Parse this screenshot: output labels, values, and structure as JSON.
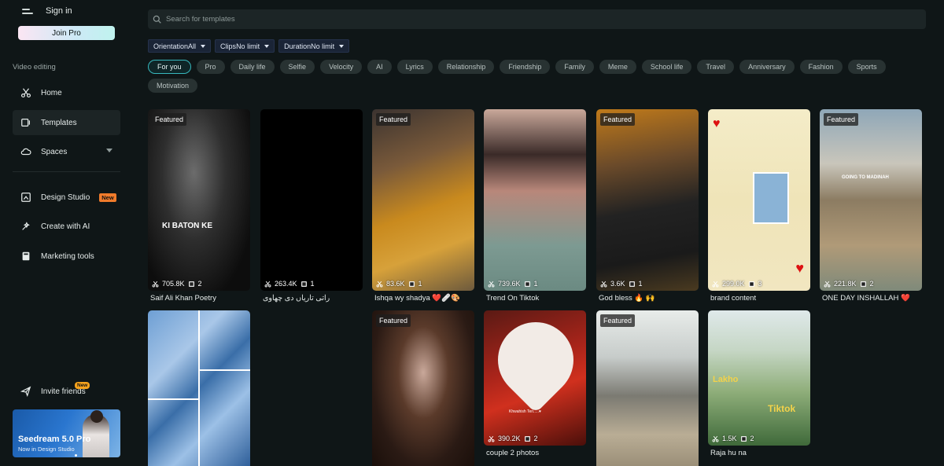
{
  "sidebar": {
    "sign_in": "Sign in",
    "join_pro": "Join Pro",
    "section_label": "Video editing",
    "nav": [
      {
        "label": "Home",
        "icon": "scissors-icon"
      },
      {
        "label": "Templates",
        "icon": "template-icon"
      },
      {
        "label": "Spaces",
        "icon": "cloud-icon"
      },
      {
        "label": "Design Studio",
        "icon": "design-icon",
        "badge": "New"
      },
      {
        "label": "Create with AI",
        "icon": "sparkle-icon"
      },
      {
        "label": "Marketing tools",
        "icon": "marketing-icon"
      }
    ],
    "invite": {
      "label": "Invite friends",
      "badge": "New"
    },
    "promo": {
      "title": "Seedream 5.0 Pro",
      "subtitle": "Now in Design Studio"
    }
  },
  "search": {
    "placeholder": "Search for templates"
  },
  "filters": [
    {
      "label": "Orientation",
      "value": "All"
    },
    {
      "label": "Clips",
      "value": "No limit"
    },
    {
      "label": "Duration",
      "value": "No limit"
    }
  ],
  "chips": [
    "For you",
    "Pro",
    "Daily life",
    "Selfie",
    "Velocity",
    "AI",
    "Lyrics",
    "Relationship",
    "Friendship",
    "Family",
    "Meme",
    "School life",
    "Travel",
    "Anniversary",
    "Fashion",
    "Sports",
    "Motivation"
  ],
  "active_chip": "For you",
  "featured_label": "Featured",
  "templates": [
    {
      "uses": "705.8K",
      "clips": "2",
      "title": "Saif Ali Khan Poetry",
      "featured": true,
      "overlay": "KI BATON KE"
    },
    {
      "uses": "263.4K",
      "clips": "1",
      "title": "راتی تاریاں دی چھاوی",
      "featured": false
    },
    {
      "uses": "83.6K",
      "clips": "1",
      "title": "Ishqa wy shadya ❤️🩹🎨",
      "featured": true
    },
    {
      "uses": "739.6K",
      "clips": "1",
      "title": "Trend On Tiktok",
      "featured": false
    },
    {
      "uses": "3.6K",
      "clips": "1",
      "title": "God bless 🔥 🙌",
      "featured": true
    },
    {
      "uses": "299.0K",
      "clips": "3",
      "title": "brand content",
      "featured": false
    },
    {
      "uses": "221.8K",
      "clips": "2",
      "title": "ONE DAY INSHALLAH ❤️",
      "featured": true,
      "overlay": "GOING TO MADINAH"
    },
    {
      "uses": "",
      "clips": "",
      "title": "",
      "featured": false
    },
    {
      "uses": "",
      "clips": "",
      "title": "",
      "featured": true
    },
    {
      "uses": "390.2K",
      "clips": "2",
      "title": "couple 2 photos",
      "featured": false,
      "overlay": "Khwahish Teri.....♥"
    },
    {
      "uses": "",
      "clips": "",
      "title": "",
      "featured": true
    },
    {
      "uses": "1.5K",
      "clips": "2",
      "title": "Raja hu na",
      "featured": false,
      "overlay": "Lakho",
      "overlay2": "Tiktok"
    }
  ]
}
